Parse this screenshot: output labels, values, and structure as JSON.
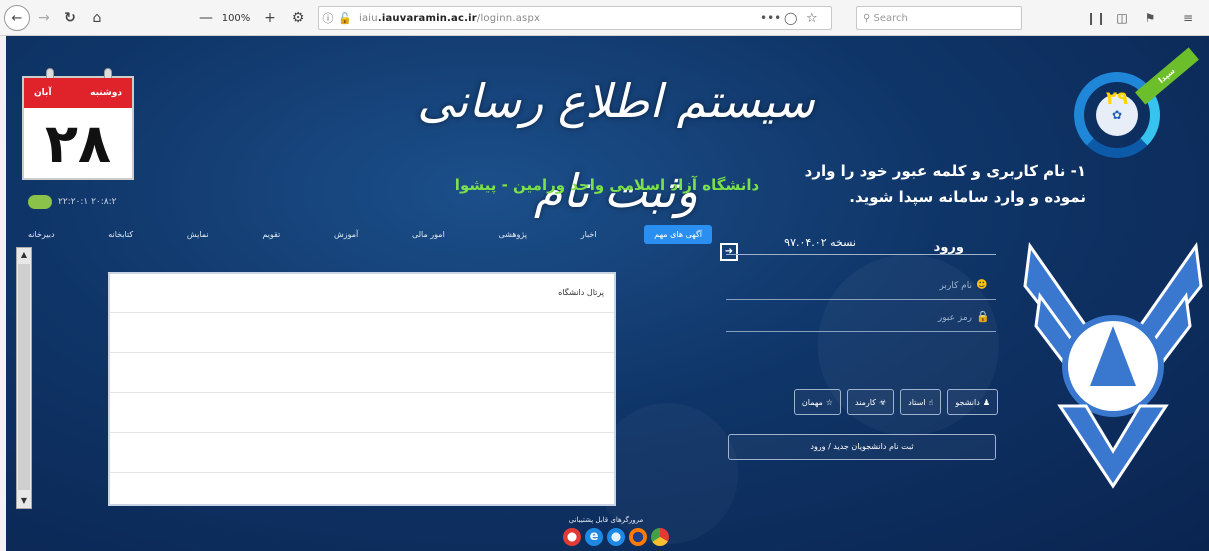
{
  "browser": {
    "zoom": "100%",
    "url_prefix": "iaiu",
    "url_domain": ".iauvaramin.ac.ir",
    "url_path": "/loginn.aspx",
    "search_placeholder": "Search",
    "page_actions": "•••"
  },
  "calendar": {
    "month": "آبان",
    "weekday": "دوشنبه",
    "day": "۲۸",
    "date_line": "۲۲:۲۰:۱ ۲۰:۸:۲"
  },
  "header": {
    "site_title": "سیستم اطلاع رسانی وثبت نام",
    "university": "دانشگاه آزاد اسلامی واحد ورامین - پیشوا",
    "instruction_line1": "۱- نام کاربری و کلمه عبور خود را وارد",
    "instruction_line2": "نموده و وارد سامانه سپدا شوید.",
    "badge_number": "۲۹",
    "badge_ribbon": "سپدا"
  },
  "nav": {
    "tabs": [
      "آگهی های مهم",
      "اخبار",
      "پژوهشی",
      "امور مالی",
      "آموزش",
      "تقویم",
      "نمایش",
      "کتابخانه",
      "دبیرخانه"
    ],
    "active_index": 0
  },
  "news": {
    "title": "پرتال دانشگاه"
  },
  "login": {
    "title": "ورود",
    "version": "نسخه ۹۷.۰۴.۰۲",
    "username_placeholder": "نام کاربر",
    "password_placeholder": "رمز عبور",
    "roles": {
      "student": "دانشجو",
      "professor": "استاد",
      "staff": "کارمند",
      "guest": "مهمان"
    },
    "register_label": "ثبت نام دانشجویان جدید / ورود"
  },
  "footer": {
    "browsers_label": "مرورگرهای قابل پشتیبانی"
  }
}
